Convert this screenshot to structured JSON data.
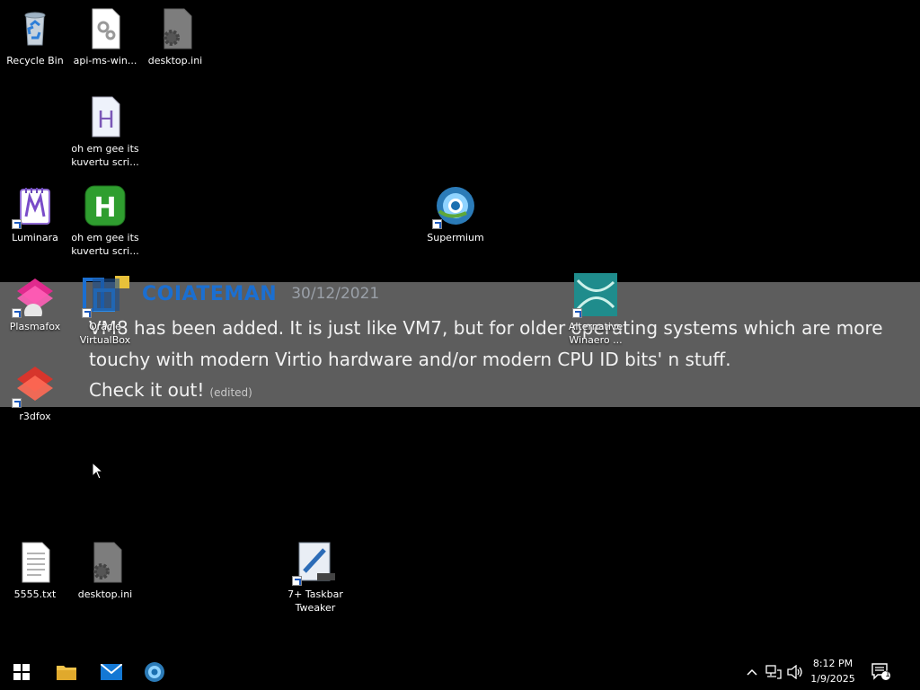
{
  "desktop": {
    "icons": [
      {
        "label": "Recycle Bin"
      },
      {
        "label": "api-ms-win..."
      },
      {
        "label": "desktop.ini"
      },
      {
        "label": "oh em gee its\nkuvertu scri..."
      },
      {
        "label": "Luminara"
      },
      {
        "label": "oh em gee its\nkuvertu scri..."
      },
      {
        "label": "Supermium"
      },
      {
        "label": "Plasmafox"
      },
      {
        "label": "Oracle\nVirtualBox"
      },
      {
        "label": "Alternative\nWinaero ..."
      },
      {
        "label": "r3dfox"
      },
      {
        "label": "5555.txt"
      },
      {
        "label": "desktop.ini"
      },
      {
        "label": "7+ Taskbar\nTweaker"
      }
    ]
  },
  "banner": {
    "author": "COIATEMAN",
    "date": "30/12/2021",
    "line1": "VM8 has been added. It is just like VM7, but for older operating systems which are more",
    "line2": "touchy with modern Virtio hardware and/or modern CPU ID bits' n stuff.",
    "line3": "Check it out!",
    "edited": "(edited)"
  },
  "taskbar": {
    "pinned": [
      "start-icon",
      "file-explorer-icon",
      "mail-icon",
      "supermium-icon"
    ],
    "tray": [
      "chevron-up-icon",
      "network-icon",
      "volume-icon"
    ],
    "time": "8:12 PM",
    "date": "1/9/2025",
    "notification_count": "1"
  },
  "colors": {
    "accent": "#1b6fd1",
    "banner_bg": "#969696",
    "desktop": "#000000"
  }
}
